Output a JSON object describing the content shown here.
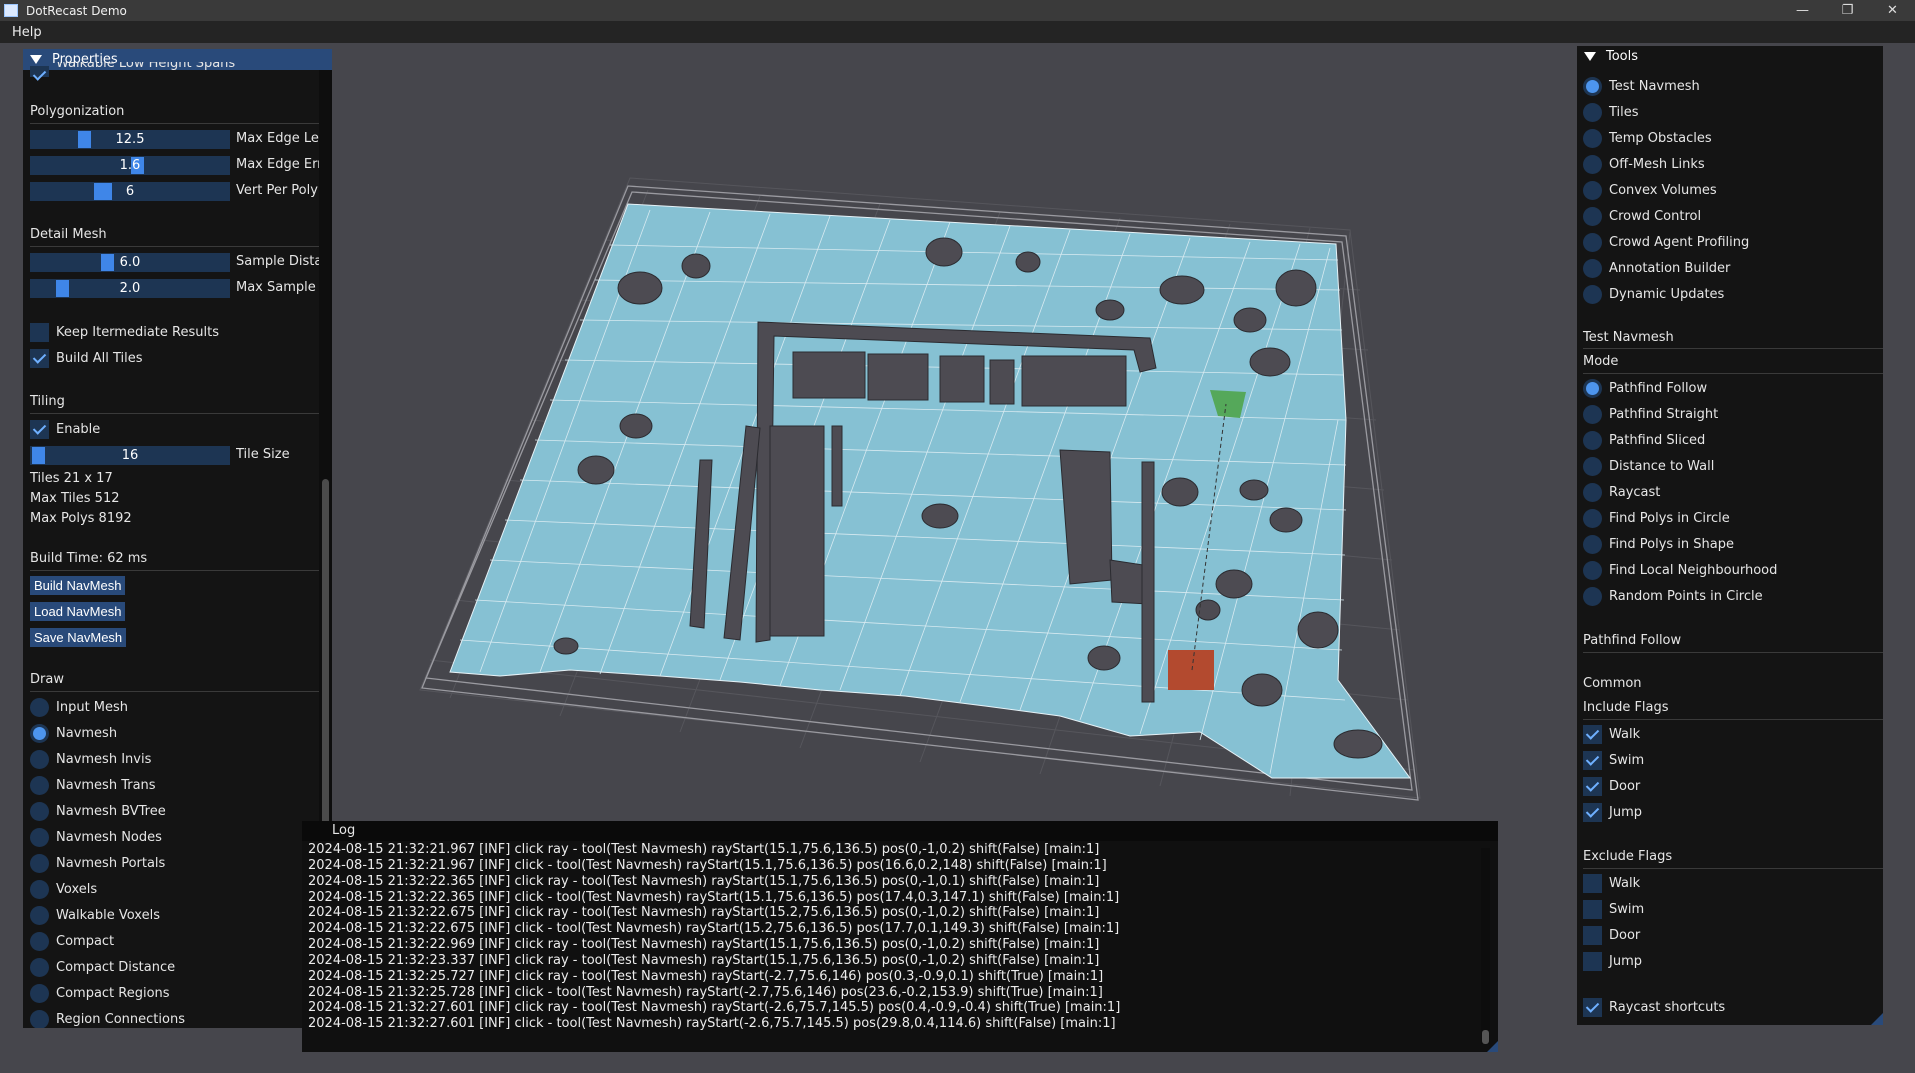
{
  "window": {
    "title": "DotRecast Demo",
    "controls": [
      "—",
      "❐",
      "✕"
    ]
  },
  "menu": {
    "help": "Help"
  },
  "colors": {
    "accent": "#3f86e8",
    "panel_header": "#294a7a",
    "navmesh": "#86c1d3",
    "wall": "#4d4b52",
    "marker_red": "#b34a2f",
    "marker_green": "#55a85a"
  },
  "properties": {
    "title": "Properties",
    "partial_row": "Walkable Low Height Spans",
    "polygonization": {
      "title": "Polygonization",
      "sliders": [
        {
          "value": "12.5",
          "label": "Max Edge Length",
          "fraction": 0.22
        },
        {
          "value": "1.6",
          "label": "Max Edge Error",
          "fraction": 0.42
        },
        {
          "value": "6",
          "label": "Vert Per Poly",
          "fraction": 0.3
        }
      ]
    },
    "detail_mesh": {
      "title": "Detail Mesh",
      "sliders": [
        {
          "value": "6.0",
          "label": "Sample Distance",
          "fraction": 0.33
        },
        {
          "value": "2.0",
          "label": "Max Sample Error",
          "fraction": 0.1
        }
      ]
    },
    "options": [
      {
        "label": "Keep Itermediate Results",
        "checked": false
      },
      {
        "label": "Build All Tiles",
        "checked": true
      }
    ],
    "tiling": {
      "title": "Tiling",
      "enable": {
        "label": "Enable",
        "checked": true
      },
      "slider": {
        "value": "16",
        "label": "Tile Size",
        "fraction": 0.02
      },
      "info": [
        "Tiles 21 x 17",
        "Max Tiles 512",
        "Max Polys 8192"
      ]
    },
    "build_time": "Build Time: 62 ms",
    "buttons": [
      "Build NavMesh",
      "Load NavMesh",
      "Save NavMesh"
    ],
    "draw": {
      "title": "Draw",
      "selected": 1,
      "items": [
        "Input Mesh",
        "Navmesh",
        "Navmesh Invis",
        "Navmesh Trans",
        "Navmesh BVTree",
        "Navmesh Nodes",
        "Navmesh Portals",
        "Voxels",
        "Walkable Voxels",
        "Compact",
        "Compact Distance",
        "Compact Regions",
        "Region Connections"
      ]
    }
  },
  "tools": {
    "title": "Tools",
    "selected": 0,
    "items": [
      "Test Navmesh",
      "Tiles",
      "Temp Obstacles",
      "Off-Mesh Links",
      "Convex Volumes",
      "Crowd Control",
      "Crowd Agent Profiling",
      "Annotation Builder",
      "Dynamic Updates"
    ],
    "section_title": "Test Navmesh",
    "mode": {
      "title": "Mode",
      "selected": 0,
      "items": [
        "Pathfind Follow",
        "Pathfind Straight",
        "Pathfind Sliced",
        "Distance to Wall",
        "Raycast",
        "Find Polys in Circle",
        "Find Polys in Shape",
        "Find Local Neighbourhood",
        "Random Points in Circle"
      ]
    },
    "active_mode_title": "Pathfind Follow",
    "common": "Common",
    "include_flags": {
      "title": "Include Flags",
      "items": [
        {
          "label": "Walk",
          "checked": true
        },
        {
          "label": "Swim",
          "checked": true
        },
        {
          "label": "Door",
          "checked": true
        },
        {
          "label": "Jump",
          "checked": true
        }
      ]
    },
    "exclude_flags": {
      "title": "Exclude Flags",
      "items": [
        {
          "label": "Walk",
          "checked": false
        },
        {
          "label": "Swim",
          "checked": false
        },
        {
          "label": "Door",
          "checked": false
        },
        {
          "label": "Jump",
          "checked": false
        }
      ]
    },
    "raycast_shortcuts": {
      "label": "Raycast shortcuts",
      "checked": true
    }
  },
  "log": {
    "title": "Log",
    "lines": [
      "2024-08-15 21:32:21.967 [INF] click ray - tool(Test Navmesh) rayStart(15.1,75.6,136.5) pos(0,-1,0.2) shift(False) [main:1]",
      "2024-08-15 21:32:21.967 [INF] click - tool(Test Navmesh) rayStart(15.1,75.6,136.5) pos(16.6,0.2,148) shift(False) [main:1]",
      "2024-08-15 21:32:22.365 [INF] click ray - tool(Test Navmesh) rayStart(15.1,75.6,136.5) pos(0,-1,0.1) shift(False) [main:1]",
      "2024-08-15 21:32:22.365 [INF] click - tool(Test Navmesh) rayStart(15.1,75.6,136.5) pos(17.4,0.3,147.1) shift(False) [main:1]",
      "2024-08-15 21:32:22.675 [INF] click ray - tool(Test Navmesh) rayStart(15.2,75.6,136.5) pos(0,-1,0.2) shift(False) [main:1]",
      "2024-08-15 21:32:22.675 [INF] click - tool(Test Navmesh) rayStart(15.2,75.6,136.5) pos(17.7,0.1,149.3) shift(False) [main:1]",
      "2024-08-15 21:32:22.969 [INF] click ray - tool(Test Navmesh) rayStart(15.1,75.6,136.5) pos(0,-1,0.2) shift(False) [main:1]",
      "2024-08-15 21:32:23.337 [INF] click ray - tool(Test Navmesh) rayStart(15.1,75.6,136.5) pos(0,-1,0.2) shift(False) [main:1]",
      "2024-08-15 21:32:25.727 [INF] click ray - tool(Test Navmesh) rayStart(-2.7,75.6,146) pos(0.3,-0.9,0.1) shift(True) [main:1]",
      "2024-08-15 21:32:25.728 [INF] click - tool(Test Navmesh) rayStart(-2.7,75.6,146) pos(23.6,-0.2,153.9) shift(True) [main:1]",
      "2024-08-15 21:32:27.601 [INF] click ray - tool(Test Navmesh) rayStart(-2.6,75.7,145.5) pos(0.4,-0.9,-0.4) shift(True) [main:1]",
      "2024-08-15 21:32:27.601 [INF] click - tool(Test Navmesh) rayStart(-2.6,75.7,145.5) pos(29.8,0.4,114.6) shift(False) [main:1]"
    ]
  }
}
